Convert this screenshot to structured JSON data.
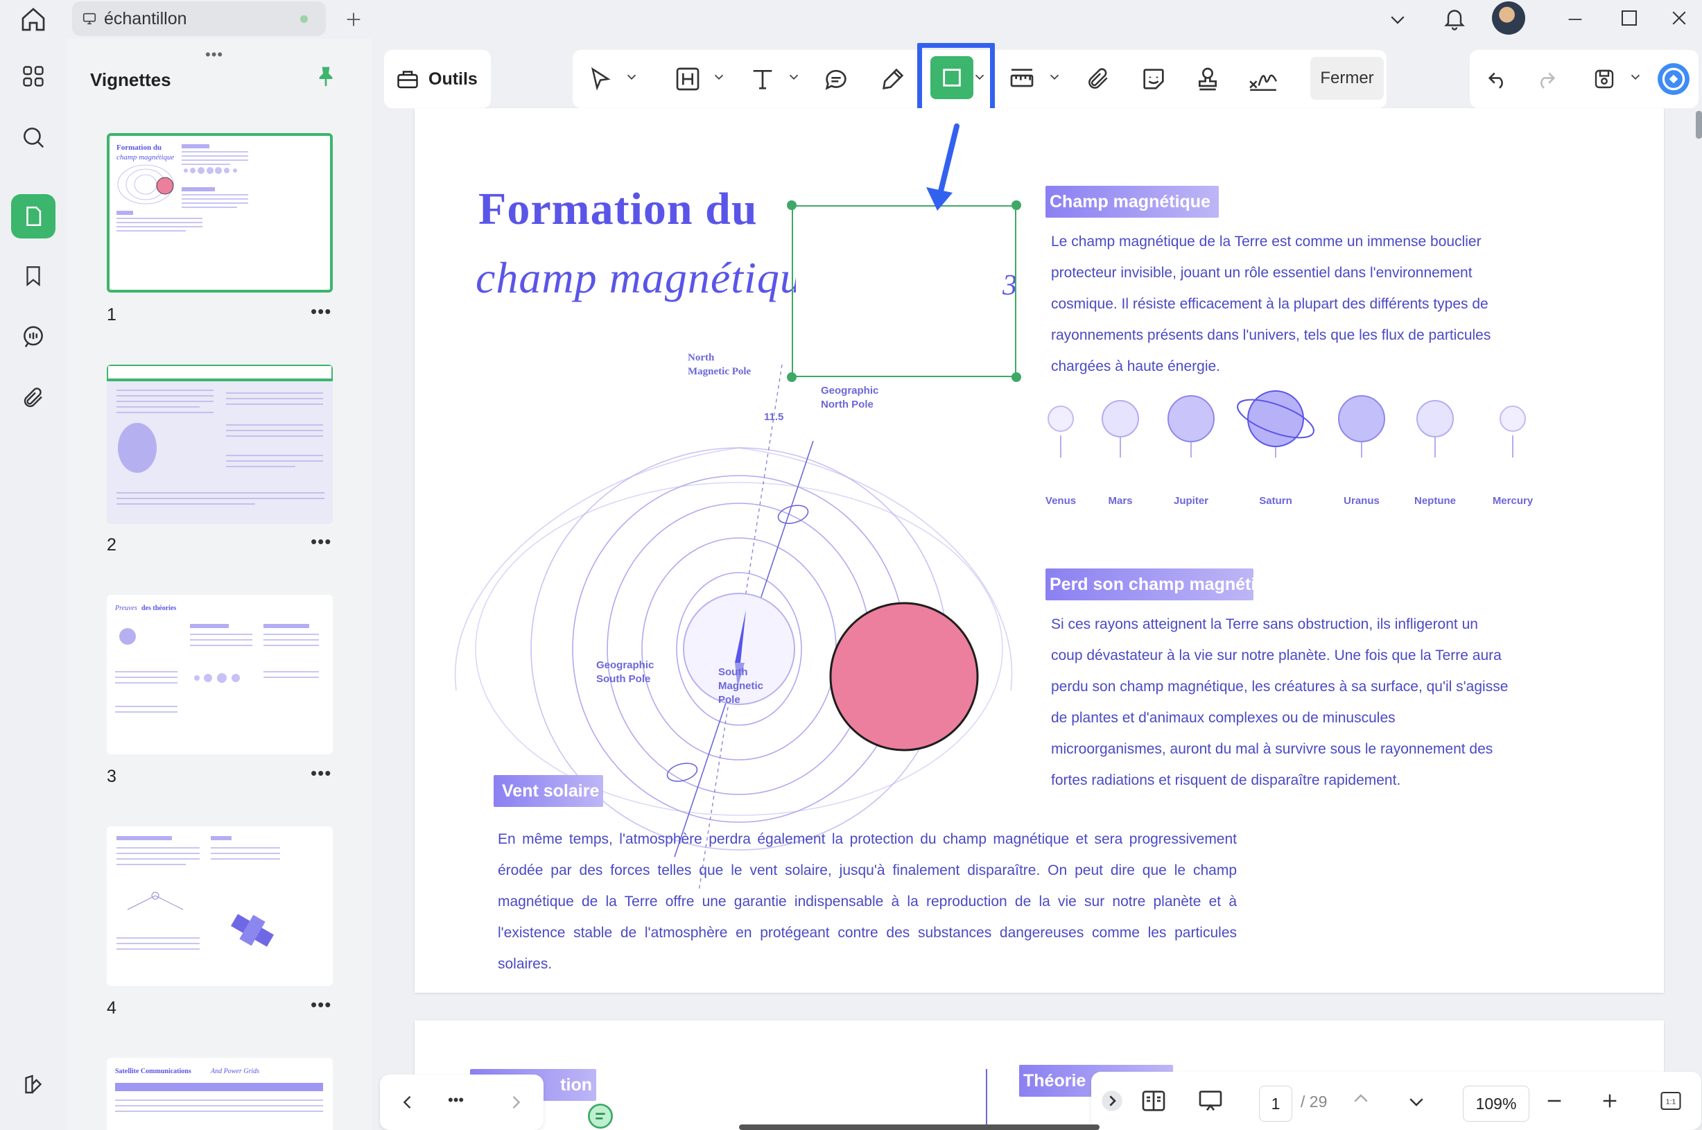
{
  "tab": {
    "name": "échantillon"
  },
  "sidebar": {
    "title": "Vignettes",
    "grip": "•••",
    "more": "•••",
    "pages": [
      "1",
      "2",
      "3",
      "4"
    ]
  },
  "toolbar": {
    "outils": "Outils",
    "fermer": "Fermer"
  },
  "document": {
    "title_line1": "Formation du",
    "title_line2": "champ magnétique",
    "title_fragment": "3",
    "sections": {
      "champ": {
        "heading": "Champ magnétique",
        "text": "Le champ magnétique de la Terre est comme un immense bouclier protecteur invisible, jouant un rôle essentiel dans l'environnement cosmique. Il résiste efficacement à la plupart des différents types de rayonnements présents dans l'univers, tels que les flux de particules chargées à haute énergie."
      },
      "perd": {
        "heading": "Perd son champ magnétique",
        "text": "Si ces rayons atteignent la Terre sans obstruction, ils infligeront un coup dévastateur à la vie sur notre planète. Une fois que la Terre aura perdu son champ magnétique, les créatures à sa surface, qu'il s'agisse de plantes et d'animaux complexes ou de minuscules microorganismes, auront du mal à survivre sous le rayonnement des fortes radiations et risquent de disparaître rapidement."
      },
      "vent": {
        "heading": "Vent solaire",
        "text": "En même temps, l'atmosphère perdra également la protection du champ magnétique et sera progressivement érodée par des forces telles que le vent solaire, jusqu'à finalement disparaître. On peut dire que le champ magnétique de la Terre offre une garantie indispensable à la reproduction de la vie sur notre planète et à l'existence stable de l'atmosphère en protégeant contre des substances dangereuses comme les particules solaires."
      }
    },
    "planets": [
      "Venus",
      "Mars",
      "Jupiter",
      "Saturn",
      "Uranus",
      "Neptune",
      "Mercury"
    ],
    "diagram": {
      "north_magnetic": [
        "North",
        "Magnetic Pole"
      ],
      "geo_north": [
        "Geographic",
        "North Pole"
      ],
      "geo_south": [
        "Geographic",
        "South Pole"
      ],
      "south_magnetic": [
        "South",
        "Magnetic",
        "Pole"
      ],
      "angle": "11.5"
    },
    "page2": {
      "heading_left": "tion",
      "heading_right": "Théorie"
    }
  },
  "navigation": {
    "more": "•••",
    "current_page": "1",
    "total_pages": "/ 29",
    "zoom": "109%"
  },
  "colors": {
    "accent_green": "#3cb56d",
    "highlight_blue": "#3361ef",
    "doc_purple": "#5a55e8",
    "planet_pink": "#ec7f9d"
  }
}
